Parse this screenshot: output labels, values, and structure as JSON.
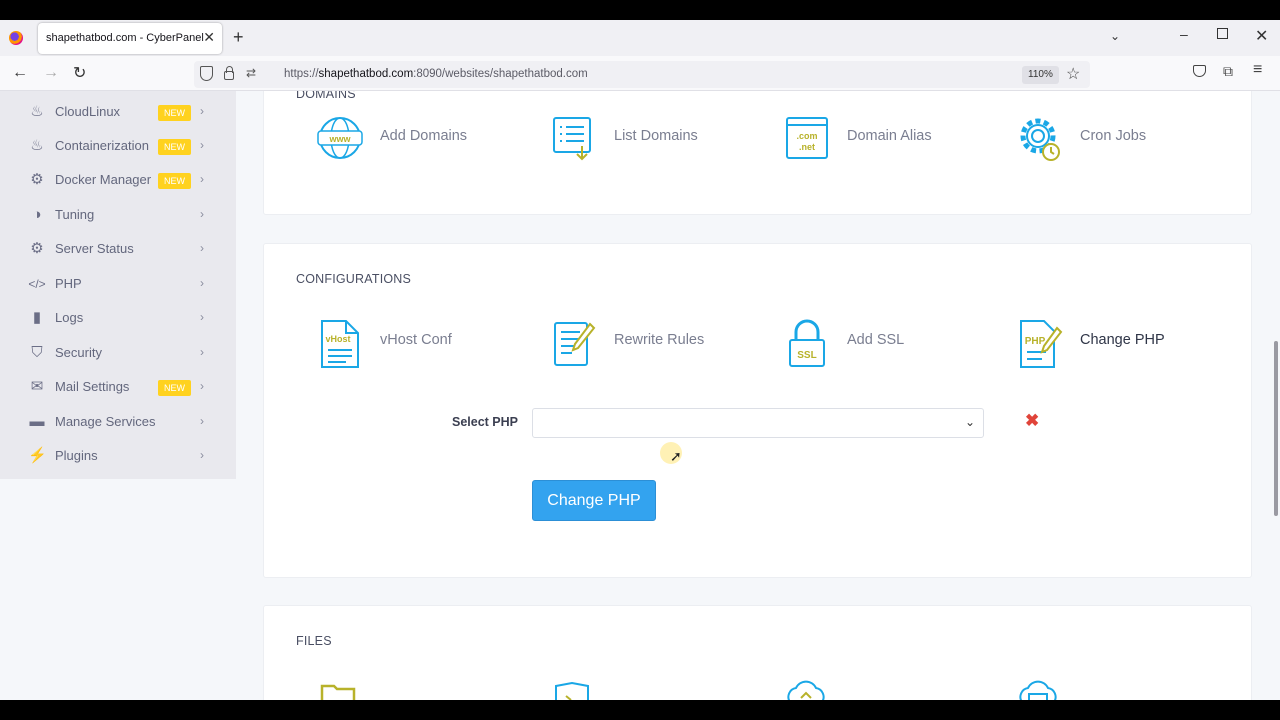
{
  "browser": {
    "tab_title": "shapethatbod.com - CyberPanel",
    "url_host": "shapethatbod.com",
    "url_prefix": "https://",
    "url_rest": ":8090/websites/shapethatbod.com",
    "zoom": "110%"
  },
  "sidebar": {
    "items": [
      {
        "label": "CloudLinux",
        "badge": "NEW"
      },
      {
        "label": "Containerization",
        "badge": "NEW"
      },
      {
        "label": "Docker Manager",
        "badge": "NEW"
      },
      {
        "label": "Tuning"
      },
      {
        "label": "Server Status"
      },
      {
        "label": "PHP"
      },
      {
        "label": "Logs"
      },
      {
        "label": "Security"
      },
      {
        "label": "Mail Settings",
        "badge": "NEW"
      },
      {
        "label": "Manage Services"
      },
      {
        "label": "Plugins"
      }
    ]
  },
  "domains": {
    "title": "DOMAINS",
    "tiles": [
      "Add Domains",
      "List Domains",
      "Domain Alias",
      "Cron Jobs"
    ]
  },
  "configurations": {
    "title": "CONFIGURATIONS",
    "tiles": [
      "vHost Conf",
      "Rewrite Rules",
      "Add SSL",
      "Change PHP"
    ],
    "select_label": "Select PHP",
    "button_label": "Change PHP"
  },
  "files": {
    "title": "FILES"
  },
  "colors": {
    "accent": "#33a3ef",
    "badge": "#ffd21f",
    "icon_blue": "#1aa7e6",
    "icon_olive": "#b8b22a"
  }
}
